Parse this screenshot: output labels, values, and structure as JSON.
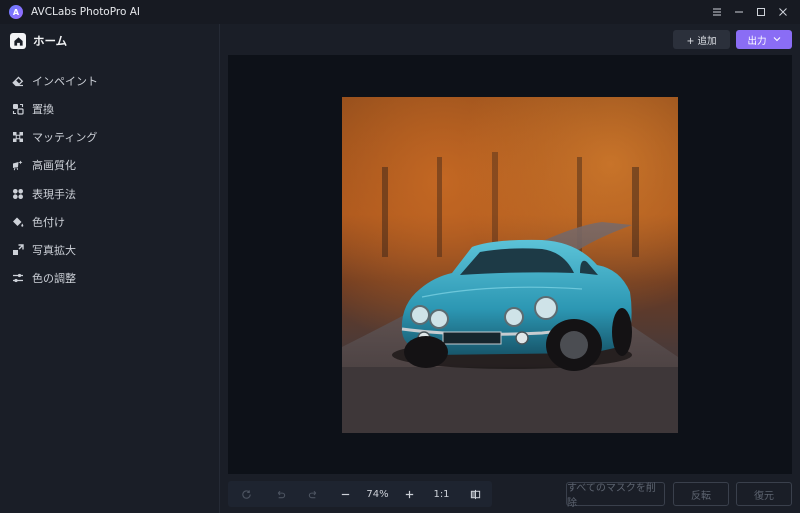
{
  "window": {
    "app_logo_text": "A",
    "title": "AVCLabs PhotoPro AI"
  },
  "sidebar": {
    "home_label": "ホーム",
    "items": [
      {
        "label": "インペイント",
        "icon": "eraser-icon"
      },
      {
        "label": "置換",
        "icon": "replace-icon"
      },
      {
        "label": "マッティング",
        "icon": "matting-icon"
      },
      {
        "label": "高画質化",
        "icon": "enhance-icon"
      },
      {
        "label": "表現手法",
        "icon": "style-icon"
      },
      {
        "label": "色付け",
        "icon": "paint-bucket-icon"
      },
      {
        "label": "写真拡大",
        "icon": "expand-icon"
      },
      {
        "label": "色の調整",
        "icon": "sliders-icon"
      }
    ]
  },
  "header": {
    "add_label": "+ 追加",
    "output_label": "出力"
  },
  "toolbar": {
    "zoom": "74%",
    "ratio": "1:1"
  },
  "actions": {
    "delete_all_masks": "すべてのマスクを削除",
    "invert": "反転",
    "restore": "復元"
  },
  "colors": {
    "accent": "#8a6df5",
    "background": "#1a1e27",
    "canvas": "#0d1118"
  }
}
